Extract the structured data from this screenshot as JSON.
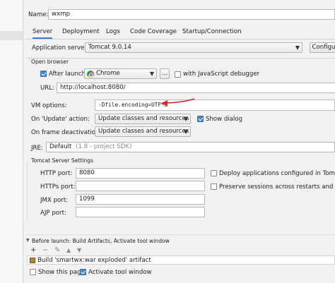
{
  "name": {
    "label": "Name:",
    "value": "wxmp"
  },
  "tabs": [
    {
      "label": "Server",
      "active": true
    },
    {
      "label": "Deployment"
    },
    {
      "label": "Logs"
    },
    {
      "label": "Code Coverage"
    },
    {
      "label": "Startup/Connection"
    }
  ],
  "app_server": {
    "label": "Application server:",
    "value": "Tomcat 9.0.14",
    "configure_label": "Configu"
  },
  "open_browser": {
    "title": "Open browser",
    "after_launch_label": "After launch",
    "after_launch_checked": true,
    "browser_value": "Chrome",
    "browse_button_label": "...",
    "js_debugger_label": "with JavaScript debugger",
    "js_debugger_checked": false,
    "url_label": "URL:",
    "url_value": "http://localhost:8080/"
  },
  "vm_options": {
    "label": "VM options:",
    "value": "-Dfile.encoding=UTF-8"
  },
  "on_update": {
    "label": "On 'Update' action:",
    "value": "Update classes and resources",
    "show_dialog_label": "Show dialog",
    "show_dialog_checked": true
  },
  "on_frame": {
    "label": "On frame deactivation:",
    "value": "Update classes and resources"
  },
  "jre": {
    "label": "JRE:",
    "value": "Default",
    "hint": "(1.8 - project SDK)"
  },
  "tomcat_settings": {
    "title": "Tomcat Server Settings",
    "http_port_label": "HTTP port:",
    "http_port_value": "8080",
    "https_port_label": "HTTPs port:",
    "https_port_value": "",
    "jmx_port_label": "JMX port:",
    "jmx_port_value": "1099",
    "ajp_port_label": "AJP port:",
    "ajp_port_value": "",
    "deploy_label": "Deploy applications configured in Tomcat in",
    "preserve_label": "Preserve sessions across restarts and redeplo"
  },
  "before_launch": {
    "title": "Before launch: Build Artifacts, Activate tool window",
    "toolbar": [
      "+",
      "−",
      "✎",
      "▲",
      "▼"
    ],
    "item": "Build 'smartwx:war exploded' artifact"
  },
  "footer": {
    "show_page_label": "Show this page",
    "show_page_checked": false,
    "activate_label": "Activate tool window",
    "activate_checked": true
  },
  "colors": {
    "accent": "#3d7ed3",
    "arrow": "#d9262b",
    "background": "#f2f2f2"
  },
  "icons": {
    "browser": "chrome-icon",
    "artifact": "artifact-icon"
  }
}
